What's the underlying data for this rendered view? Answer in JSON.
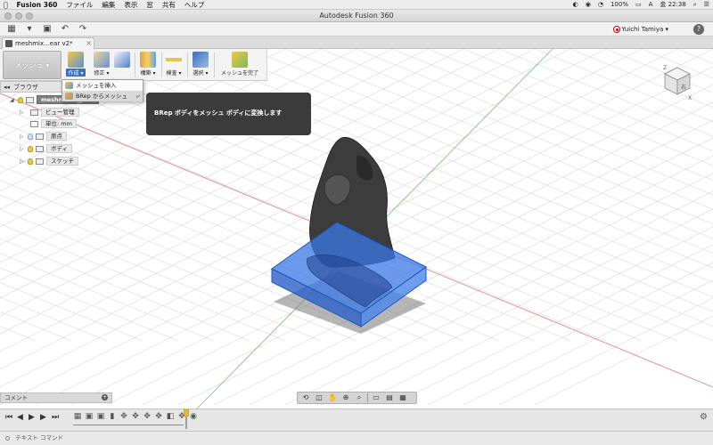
{
  "menubar": {
    "apple": "",
    "app_name": "Fusion 360",
    "items": [
      "ファイル",
      "編集",
      "表示",
      "窓",
      "共有",
      "ヘルプ"
    ],
    "battery": "100%",
    "ime": "A",
    "datetime": "金 22:38"
  },
  "window": {
    "title": "Autodesk Fusion 360"
  },
  "app_toolbar": {
    "user_name": "Yuichi Tamiya ▾",
    "help_label": "?"
  },
  "document_tab": {
    "label": "meshmix...ear v2*"
  },
  "ribbon": {
    "workspace_label": "メッシュ ▾",
    "buttons": [
      {
        "label": "作成 ▾"
      },
      {
        "label": "修正 ▾"
      },
      {
        "label": "構築 ▾"
      },
      {
        "label": "検査 ▾"
      },
      {
        "label": "選択 ▾"
      },
      {
        "label": "メッシュを完了"
      }
    ]
  },
  "create_menu": {
    "items": [
      {
        "label": "メッシュを挿入"
      },
      {
        "label": "BRep からメッシュ"
      }
    ]
  },
  "tooltip": {
    "text": "BRep ボディをメッシュ ボディに変換します"
  },
  "browser": {
    "header": "ブラウザ",
    "root_label": "meshmixer_plan",
    "rows": [
      {
        "label": "ビュー管理"
      },
      {
        "label": "単位: mm"
      },
      {
        "label": "原点"
      },
      {
        "label": "ボディ"
      },
      {
        "label": "スケッチ"
      }
    ]
  },
  "viewcube": {
    "axis_z": "Z",
    "axis_x": "X",
    "face_label": "右"
  },
  "comment_panel": {
    "label": "コメント"
  },
  "text_command": {
    "label": "テキスト コマンド"
  },
  "colors": {
    "selection_blue": "#2f6fe0",
    "rock_dark": "#3a3a3a",
    "grid_line": "#d6d6d6",
    "axis_red": "#e06060",
    "axis_green": "#60b060"
  }
}
